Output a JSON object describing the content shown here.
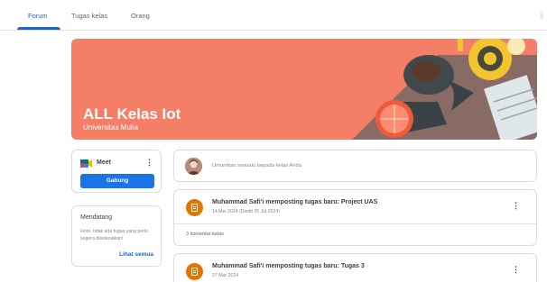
{
  "tabs": [
    {
      "label": "Forum",
      "active": true
    },
    {
      "label": "Tugas kelas",
      "active": false
    },
    {
      "label": "Orang",
      "active": false
    }
  ],
  "banner": {
    "title": "ALL Kelas Iot",
    "subtitle": "Universitas Mulia",
    "color": "#f47f66"
  },
  "meet": {
    "label": "Meet",
    "join_label": "Gabung"
  },
  "upcoming": {
    "title": "Mendatang",
    "text": "Hore, tidak ada tugas yang perlu segera diselesaikan!",
    "link": "Lihat semua"
  },
  "announce": {
    "placeholder": "Umumkan sesuatu kepada kelas Anda"
  },
  "posts": [
    {
      "title": "Muhammad Safi'i memposting tugas baru: Project UAS",
      "date": "14 Mei 2024 (Diedit 25 Jul 2024)",
      "comments": "3 komentar kelas"
    },
    {
      "title": "Muhammad Safi'i memposting tugas baru: Tugas 3",
      "date": "27 Mar 2024"
    }
  ],
  "colors": {
    "accent": "#1967d2",
    "button": "#1a73e8",
    "assignment_icon": "#e37400"
  }
}
